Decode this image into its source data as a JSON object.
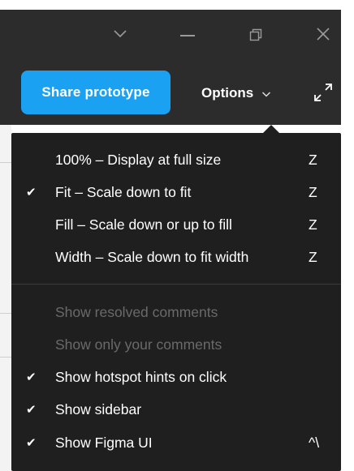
{
  "toolbar": {
    "share_label": "Share prototype",
    "options_label": "Options"
  },
  "menu": {
    "zoom_items": [
      {
        "label": "100% – Display at full size",
        "shortcut": "Z",
        "checked": false
      },
      {
        "label": "Fit – Scale down to fit",
        "shortcut": "Z",
        "checked": true
      },
      {
        "label": "Fill – Scale down or up to fill",
        "shortcut": "Z",
        "checked": false
      },
      {
        "label": "Width – Scale down to fit width",
        "shortcut": "Z",
        "checked": false
      }
    ],
    "view_items": [
      {
        "label": "Show resolved comments",
        "shortcut": "",
        "checked": false,
        "disabled": true
      },
      {
        "label": "Show only your comments",
        "shortcut": "",
        "checked": false,
        "disabled": true
      },
      {
        "label": "Show hotspot hints on click",
        "shortcut": "",
        "checked": true,
        "disabled": false
      },
      {
        "label": "Show sidebar",
        "shortcut": "",
        "checked": true,
        "disabled": false
      },
      {
        "label": "Show Figma UI",
        "shortcut": "^\\",
        "checked": true,
        "disabled": false
      }
    ]
  },
  "colors": {
    "accent": "#1ba1f2",
    "chrome": "#2c2c2c",
    "menu_bg": "#1f1f1f",
    "disabled_text": "#6a6a6a"
  },
  "icons": {
    "titlebar": [
      "chevron-down-icon",
      "minimize-icon",
      "restore-icon",
      "close-icon"
    ],
    "toolbar": [
      "chevron-down-icon",
      "expand-icon"
    ],
    "menu": "checkmark-icon"
  }
}
